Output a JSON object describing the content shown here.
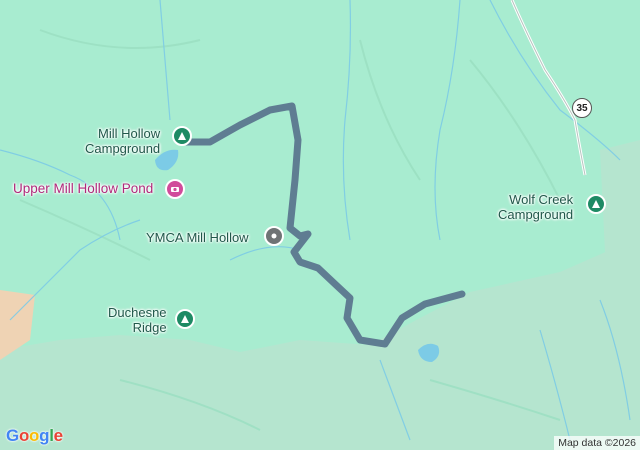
{
  "map": {
    "places": [
      {
        "id": "mill-hollow-campground",
        "line1": "Mill Hollow",
        "line2": "Campground",
        "icon": "campground-icon"
      },
      {
        "id": "upper-mill-hollow-pond",
        "line1": "Upper Mill Hollow Pond",
        "icon": "camera-icon"
      },
      {
        "id": "ymca-mill-hollow",
        "line1": "YMCA Mill Hollow",
        "icon": "place-pin-icon"
      },
      {
        "id": "duchesne-ridge",
        "line1": "Duchesne",
        "line2": "Ridge",
        "icon": "campground-icon"
      },
      {
        "id": "wolf-creek-campground",
        "line1": "Wolf Creek",
        "line2": "Campground",
        "icon": "campground-icon"
      }
    ],
    "road_shield": "35",
    "route_color": "#5f7d92",
    "attribution": "Map data ©2026",
    "logo": [
      "G",
      "o",
      "o",
      "g",
      "l",
      "e"
    ]
  }
}
